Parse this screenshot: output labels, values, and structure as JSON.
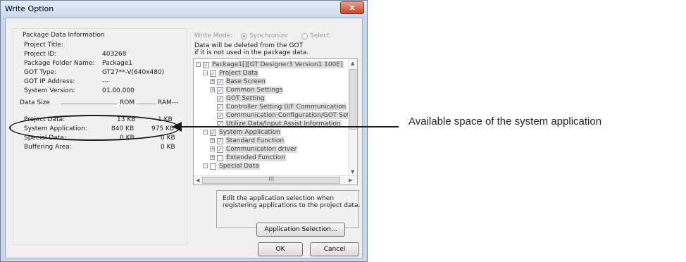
{
  "window": {
    "title": "Write Option",
    "close_glyph": "x"
  },
  "package_info": {
    "group_title": "Package Data Information",
    "rows": [
      {
        "label": "Project Title:",
        "value": ""
      },
      {
        "label": "Project ID:",
        "value": "403268"
      },
      {
        "label": "Package Folder Name:",
        "value": "Package1"
      },
      {
        "label": "GOT Type:",
        "value": "GT27**-V(640x480)"
      },
      {
        "label": "GOT IP Address:",
        "value": "---"
      },
      {
        "label": "System Version:",
        "value": "01.00.000"
      }
    ]
  },
  "data_size": {
    "label": "Data Size",
    "rom_header": "ROM",
    "ram_header": "RAM---",
    "rows": [
      {
        "label": "Project Data:",
        "rom": "13 KB",
        "ram": "1 KB"
      },
      {
        "label": "System Application:",
        "rom": "840 KB",
        "ram": "975 KB"
      },
      {
        "label": "Special Data:",
        "rom": "0 KB",
        "ram": "0 KB"
      },
      {
        "label": "Buffering Area:",
        "rom": "",
        "ram": "0 KB"
      }
    ]
  },
  "write_mode": {
    "label": "Write Mode:",
    "options": [
      "Synchronize",
      "Select"
    ],
    "selected": "Synchronize"
  },
  "notice": {
    "line1": "Data will be deleted from the GOT",
    "line2": "if it is not used in the package data."
  },
  "tree": {
    "items": [
      {
        "label": "Package1[][GT Designer3 Version1 100E]",
        "expander": "-",
        "checked": true
      },
      {
        "label": "Project Data",
        "expander": "-",
        "checked": true
      },
      {
        "label": "Base Screen",
        "expander": "+",
        "checked": true
      },
      {
        "label": "Common Settings",
        "expander": "+",
        "checked": true
      },
      {
        "label": "GOT Setting",
        "expander": "",
        "checked": true
      },
      {
        "label": "Controller Setting (I/F Communication",
        "expander": "",
        "checked": true
      },
      {
        "label": "Communication Configuration/GOT Set",
        "expander": "",
        "checked": true
      },
      {
        "label": "Utilize Data/Input Assist Information",
        "expander": "",
        "checked": true
      },
      {
        "label": "System Application",
        "expander": "-",
        "checked": true
      },
      {
        "label": "Standard Function",
        "expander": "+",
        "checked": true
      },
      {
        "label": "Communication driver",
        "expander": "+",
        "checked": true
      },
      {
        "label": "Extended Function",
        "expander": "+",
        "checked": false
      },
      {
        "label": "Special Data",
        "expander": "-",
        "checked": false
      }
    ],
    "hscroll_grip": "III"
  },
  "info_box": {
    "line1": "Edit the application selection when",
    "line2": "registering applications to the project data.",
    "app_button": "Application Selection..."
  },
  "buttons": {
    "ok": "OK",
    "cancel": "Cancel"
  },
  "annotation": {
    "text": "Available space of the system application"
  }
}
